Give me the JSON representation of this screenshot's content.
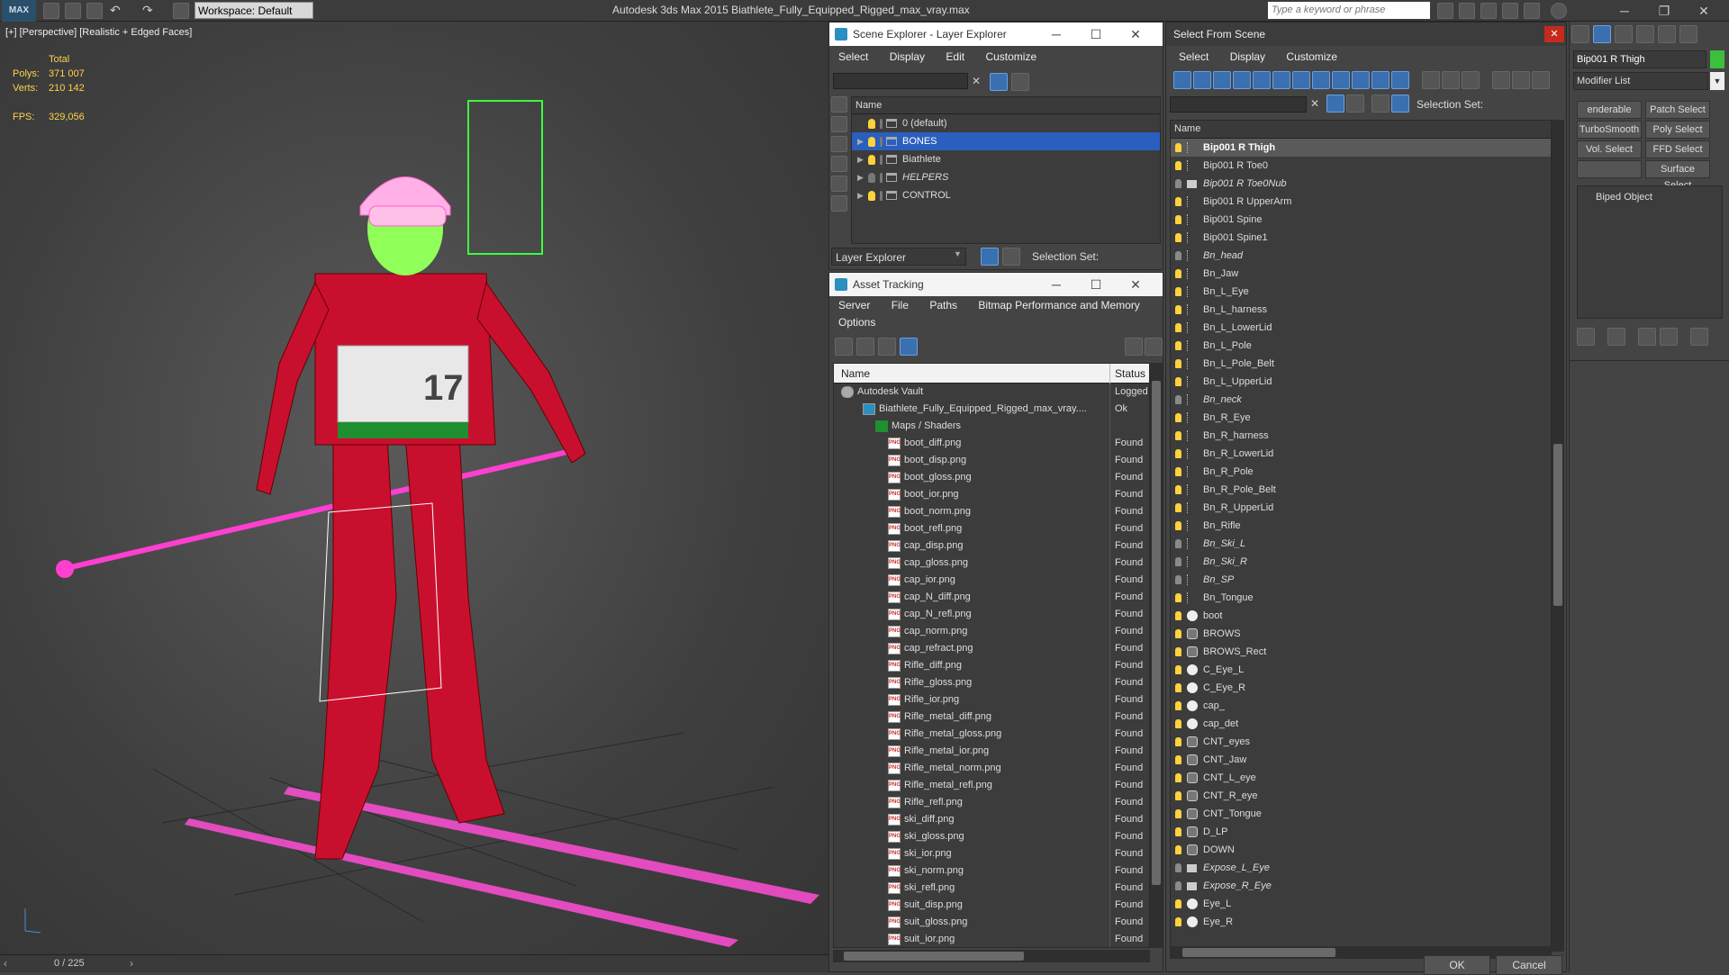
{
  "titlebar": {
    "logo": "MAX",
    "workspace": "Workspace: Default",
    "title": "Autodesk 3ds Max  2015    Biathlete_Fully_Equipped_Rigged_max_vray.max",
    "search_placeholder": "Type a keyword or phrase"
  },
  "viewport": {
    "label": "[+] [Perspective] [Realistic + Edged Faces]",
    "stats": {
      "total_label": "Total",
      "polys_label": "Polys:",
      "polys": "371 007",
      "verts_label": "Verts:",
      "verts": "210 142",
      "fps_label": "FPS:",
      "fps": "329,056"
    },
    "bib_number": "17"
  },
  "timeline": {
    "frame": "0 / 225"
  },
  "scene_explorer": {
    "title": "Scene Explorer - Layer Explorer",
    "menu": [
      "Select",
      "Display",
      "Edit",
      "Customize"
    ],
    "header": "Name",
    "layers": [
      {
        "name": "0 (default)",
        "selected": false,
        "expand": false,
        "italic": false
      },
      {
        "name": "BONES",
        "selected": true,
        "expand": true,
        "italic": false
      },
      {
        "name": "Biathlete",
        "selected": false,
        "expand": true,
        "italic": false
      },
      {
        "name": "HELPERS",
        "selected": false,
        "expand": true,
        "italic": true
      },
      {
        "name": "CONTROL",
        "selected": false,
        "expand": true,
        "italic": false
      }
    ],
    "footer_dropdown": "Layer Explorer",
    "footer_selection": "Selection Set:"
  },
  "asset_tracking": {
    "title": "Asset Tracking",
    "menu": [
      "Server",
      "File",
      "Paths",
      "Bitmap Performance and Memory"
    ],
    "menu2": [
      "Options"
    ],
    "col_name": "Name",
    "col_status": "Status",
    "rows": [
      {
        "name": "Autodesk Vault",
        "status": "Logged",
        "indent": 0,
        "type": "vault"
      },
      {
        "name": "Biathlete_Fully_Equipped_Rigged_max_vray....",
        "status": "Ok",
        "indent": 1,
        "type": "max"
      },
      {
        "name": "Maps / Shaders",
        "status": "",
        "indent": 2,
        "type": "maps"
      },
      {
        "name": "boot_diff.png",
        "status": "Found",
        "indent": 3,
        "type": "png"
      },
      {
        "name": "boot_disp.png",
        "status": "Found",
        "indent": 3,
        "type": "png"
      },
      {
        "name": "boot_gloss.png",
        "status": "Found",
        "indent": 3,
        "type": "png"
      },
      {
        "name": "boot_ior.png",
        "status": "Found",
        "indent": 3,
        "type": "png"
      },
      {
        "name": "boot_norm.png",
        "status": "Found",
        "indent": 3,
        "type": "png"
      },
      {
        "name": "boot_refl.png",
        "status": "Found",
        "indent": 3,
        "type": "png"
      },
      {
        "name": "cap_disp.png",
        "status": "Found",
        "indent": 3,
        "type": "png"
      },
      {
        "name": "cap_gloss.png",
        "status": "Found",
        "indent": 3,
        "type": "png"
      },
      {
        "name": "cap_ior.png",
        "status": "Found",
        "indent": 3,
        "type": "png"
      },
      {
        "name": "cap_N_diff.png",
        "status": "Found",
        "indent": 3,
        "type": "png"
      },
      {
        "name": "cap_N_refl.png",
        "status": "Found",
        "indent": 3,
        "type": "png"
      },
      {
        "name": "cap_norm.png",
        "status": "Found",
        "indent": 3,
        "type": "png"
      },
      {
        "name": "cap_refract.png",
        "status": "Found",
        "indent": 3,
        "type": "png"
      },
      {
        "name": "Rifle_diff.png",
        "status": "Found",
        "indent": 3,
        "type": "png"
      },
      {
        "name": "Rifle_gloss.png",
        "status": "Found",
        "indent": 3,
        "type": "png"
      },
      {
        "name": "Rifle_ior.png",
        "status": "Found",
        "indent": 3,
        "type": "png"
      },
      {
        "name": "Rifle_metal_diff.png",
        "status": "Found",
        "indent": 3,
        "type": "png"
      },
      {
        "name": "Rifle_metal_gloss.png",
        "status": "Found",
        "indent": 3,
        "type": "png"
      },
      {
        "name": "Rifle_metal_ior.png",
        "status": "Found",
        "indent": 3,
        "type": "png"
      },
      {
        "name": "Rifle_metal_norm.png",
        "status": "Found",
        "indent": 3,
        "type": "png"
      },
      {
        "name": "Rifle_metal_refl.png",
        "status": "Found",
        "indent": 3,
        "type": "png"
      },
      {
        "name": "Rifle_refl.png",
        "status": "Found",
        "indent": 3,
        "type": "png"
      },
      {
        "name": "ski_diff.png",
        "status": "Found",
        "indent": 3,
        "type": "png"
      },
      {
        "name": "ski_gloss.png",
        "status": "Found",
        "indent": 3,
        "type": "png"
      },
      {
        "name": "ski_ior.png",
        "status": "Found",
        "indent": 3,
        "type": "png"
      },
      {
        "name": "ski_norm.png",
        "status": "Found",
        "indent": 3,
        "type": "png"
      },
      {
        "name": "ski_refl.png",
        "status": "Found",
        "indent": 3,
        "type": "png"
      },
      {
        "name": "suit_disp.png",
        "status": "Found",
        "indent": 3,
        "type": "png"
      },
      {
        "name": "suit_gloss.png",
        "status": "Found",
        "indent": 3,
        "type": "png"
      },
      {
        "name": "suit_ior.png",
        "status": "Found",
        "indent": 3,
        "type": "png"
      }
    ]
  },
  "select_from_scene": {
    "title": "Select From Scene",
    "menu": [
      "Select",
      "Display",
      "Customize"
    ],
    "selection_set": "Selection Set:",
    "header": "Name",
    "items": [
      {
        "name": "Bip001 R Thigh",
        "icon": "bone",
        "on": true,
        "italic": false,
        "hl": true
      },
      {
        "name": "Bip001 R Toe0",
        "icon": "bone",
        "on": true,
        "italic": false
      },
      {
        "name": "Bip001 R Toe0Nub",
        "icon": "eye",
        "on": false,
        "italic": true
      },
      {
        "name": "Bip001 R UpperArm",
        "icon": "bone",
        "on": true,
        "italic": false
      },
      {
        "name": "Bip001 Spine",
        "icon": "bone",
        "on": true,
        "italic": false
      },
      {
        "name": "Bip001 Spine1",
        "icon": "bone",
        "on": true,
        "italic": false
      },
      {
        "name": "Bn_head",
        "icon": "bone",
        "on": false,
        "italic": true
      },
      {
        "name": "Bn_Jaw",
        "icon": "bone",
        "on": true,
        "italic": false
      },
      {
        "name": "Bn_L_Eye",
        "icon": "bone",
        "on": true,
        "italic": false
      },
      {
        "name": "Bn_L_harness",
        "icon": "bone",
        "on": true,
        "italic": false
      },
      {
        "name": "Bn_L_LowerLid",
        "icon": "bone",
        "on": true,
        "italic": false
      },
      {
        "name": "Bn_L_Pole",
        "icon": "bone",
        "on": true,
        "italic": false
      },
      {
        "name": "Bn_L_Pole_Belt",
        "icon": "bone",
        "on": true,
        "italic": false
      },
      {
        "name": "Bn_L_UpperLid",
        "icon": "bone",
        "on": true,
        "italic": false
      },
      {
        "name": "Bn_neck",
        "icon": "bone",
        "on": false,
        "italic": true
      },
      {
        "name": "Bn_R_Eye",
        "icon": "bone",
        "on": true,
        "italic": false
      },
      {
        "name": "Bn_R_harness",
        "icon": "bone",
        "on": true,
        "italic": false
      },
      {
        "name": "Bn_R_LowerLid",
        "icon": "bone",
        "on": true,
        "italic": false
      },
      {
        "name": "Bn_R_Pole",
        "icon": "bone",
        "on": true,
        "italic": false
      },
      {
        "name": "Bn_R_Pole_Belt",
        "icon": "bone",
        "on": true,
        "italic": false
      },
      {
        "name": "Bn_R_UpperLid",
        "icon": "bone",
        "on": true,
        "italic": false
      },
      {
        "name": "Bn_Rifle",
        "icon": "bone",
        "on": true,
        "italic": false
      },
      {
        "name": "Bn_Ski_L",
        "icon": "bone",
        "on": false,
        "italic": true
      },
      {
        "name": "Bn_Ski_R",
        "icon": "bone",
        "on": false,
        "italic": true
      },
      {
        "name": "Bn_SP",
        "icon": "bone",
        "on": false,
        "italic": true
      },
      {
        "name": "Bn_Tongue",
        "icon": "bone",
        "on": true,
        "italic": false
      },
      {
        "name": "boot",
        "icon": "sphere",
        "on": true,
        "italic": false
      },
      {
        "name": "BROWS",
        "icon": "shape",
        "on": true,
        "italic": false
      },
      {
        "name": "BROWS_Rect",
        "icon": "shape",
        "on": true,
        "italic": false
      },
      {
        "name": "C_Eye_L",
        "icon": "sphere",
        "on": true,
        "italic": false
      },
      {
        "name": "C_Eye_R",
        "icon": "sphere",
        "on": true,
        "italic": false
      },
      {
        "name": "cap_",
        "icon": "sphere",
        "on": true,
        "italic": false
      },
      {
        "name": "cap_det",
        "icon": "sphere",
        "on": true,
        "italic": false
      },
      {
        "name": "CNT_eyes",
        "icon": "shape",
        "on": true,
        "italic": false
      },
      {
        "name": "CNT_Jaw",
        "icon": "shape",
        "on": true,
        "italic": false
      },
      {
        "name": "CNT_L_eye",
        "icon": "shape",
        "on": true,
        "italic": false
      },
      {
        "name": "CNT_R_eye",
        "icon": "shape",
        "on": true,
        "italic": false
      },
      {
        "name": "CNT_Tongue",
        "icon": "shape",
        "on": true,
        "italic": false
      },
      {
        "name": "D_LP",
        "icon": "shape",
        "on": true,
        "italic": false
      },
      {
        "name": "DOWN",
        "icon": "shape",
        "on": true,
        "italic": false
      },
      {
        "name": "Expose_L_Eye",
        "icon": "eye",
        "on": false,
        "italic": true
      },
      {
        "name": "Expose_R_Eye",
        "icon": "eye",
        "on": false,
        "italic": true
      },
      {
        "name": "Eye_L",
        "icon": "sphere",
        "on": true,
        "italic": false
      },
      {
        "name": "Eye_R",
        "icon": "sphere",
        "on": true,
        "italic": false
      }
    ],
    "ok": "OK",
    "cancel": "Cancel"
  },
  "command_panel": {
    "object_name": "Bip001 R Thigh",
    "modifier_list": "Modifier List",
    "buttons": [
      "enderable Spli",
      "Patch Select",
      "TurboSmooth",
      "Poly Select",
      "Vol. Select",
      "FFD Select",
      "",
      "Surface Select"
    ],
    "stack_item": "Biped Object",
    "color_swatch": "#3cbf3c"
  }
}
